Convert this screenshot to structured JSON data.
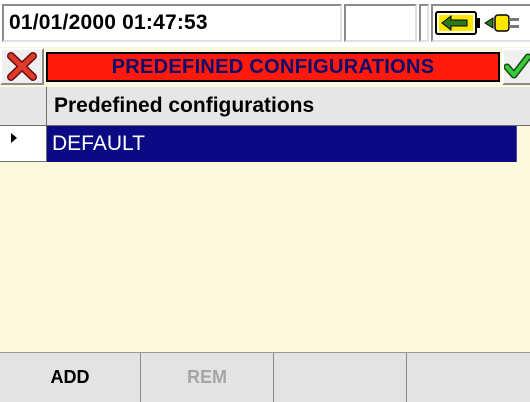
{
  "status": {
    "datetime": "01/01/2000 01:47:53",
    "power_icon": "battery-plug-icon"
  },
  "titlebar": {
    "title": "PREDEFINED CONFIGURATIONS",
    "cancel_icon": "close-icon",
    "confirm_icon": "checkmark-icon"
  },
  "table": {
    "header": "Predefined configurations",
    "rows": [
      {
        "label": "DEFAULT",
        "selected": true
      }
    ]
  },
  "function_keys": [
    {
      "label": "ADD",
      "enabled": true
    },
    {
      "label": "REM",
      "enabled": false
    },
    {
      "label": "",
      "enabled": false
    },
    {
      "label": "",
      "enabled": false
    }
  ],
  "colors": {
    "title_background": "#ff1a0c",
    "title_text": "#0b0b6b",
    "selection_background": "#0a0a84",
    "screen_background": "#fbf8dc"
  }
}
